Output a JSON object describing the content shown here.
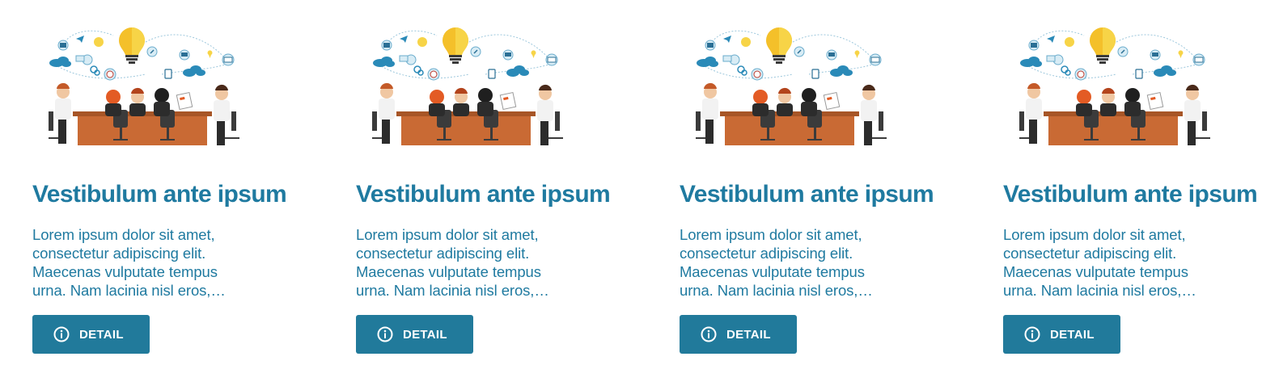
{
  "cards": [
    {
      "title": "Vestibulum ante ipsum",
      "text": "Lorem ipsum dolor sit amet, consectetur adipiscing elit. Maecenas vulputate tempus urna. Nam lacinia nisl eros,…",
      "button": {
        "label": "DETAIL",
        "icon": "info-circle-icon"
      },
      "image": "team-meeting-illustration"
    },
    {
      "title": "Vestibulum ante ipsum",
      "text": "Lorem ipsum dolor sit amet, consectetur adipiscing elit. Maecenas vulputate tempus urna. Nam lacinia nisl eros,…",
      "button": {
        "label": "DETAIL",
        "icon": "info-circle-icon"
      },
      "image": "team-meeting-illustration"
    },
    {
      "title": "Vestibulum ante ipsum",
      "text": "Lorem ipsum dolor sit amet, consectetur adipiscing elit. Maecenas vulputate tempus urna. Nam lacinia nisl eros,…",
      "button": {
        "label": "DETAIL",
        "icon": "info-circle-icon"
      },
      "image": "team-meeting-illustration"
    },
    {
      "title": "Vestibulum ante ipsum",
      "text": "Lorem ipsum dolor sit amet, consectetur adipiscing elit. Maecenas vulputate tempus urna. Nam lacinia nisl eros,…",
      "button": {
        "label": "DETAIL",
        "icon": "info-circle-icon"
      },
      "image": "team-meeting-illustration"
    }
  ],
  "colors": {
    "accent": "#1f7aa0",
    "button": "#217a9b",
    "table": "#c96a34",
    "bulb": "#f4c02a"
  }
}
